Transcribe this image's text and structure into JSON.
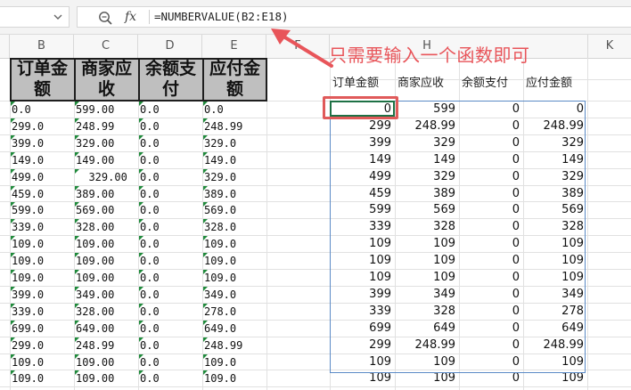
{
  "formula_bar": {
    "formula": "=NUMBERVALUE(B2:E18)",
    "fx_label": "fx"
  },
  "columns": [
    "B",
    "C",
    "D",
    "E",
    "F",
    "H",
    "K"
  ],
  "source_table": {
    "headers": [
      [
        "订单金",
        "额"
      ],
      [
        "商家应",
        "收"
      ],
      [
        "余额支",
        "付"
      ],
      [
        "应付金",
        "额"
      ]
    ],
    "rows": [
      [
        "0.0",
        "599.00",
        "0.0",
        "0.0"
      ],
      [
        "299.0",
        "248.99",
        "0.0",
        "248.99"
      ],
      [
        "399.0",
        "329.00",
        "0.0",
        "329.0"
      ],
      [
        "149.0",
        "149.00",
        "0.0",
        "149.0"
      ],
      [
        "499.0",
        "  329.00",
        "0.0",
        "329.0"
      ],
      [
        "459.0",
        "389.00",
        "0.0",
        "389.0"
      ],
      [
        "599.0",
        "569.00",
        "0.0",
        "569.0"
      ],
      [
        "339.0",
        "328.00",
        "0.0",
        "328.0"
      ],
      [
        "109.0",
        "109.00",
        "0.0",
        "109.0"
      ],
      [
        "109.0",
        "109.00",
        "0.0",
        "109.0"
      ],
      [
        "109.0",
        "109.00",
        "0.0",
        "109.0"
      ],
      [
        "399.0",
        "349.00",
        "0.0",
        "349.0"
      ],
      [
        "339.0",
        "328.00",
        "0.0",
        "278.0"
      ],
      [
        "699.0",
        "649.00",
        "0.0",
        "649.0"
      ],
      [
        "299.0",
        "248.99",
        "0.0",
        "248.99"
      ],
      [
        "109.0",
        "109.00",
        "0.0",
        "109.0"
      ],
      [
        "109.0",
        "109.00",
        "0.0",
        "109.0"
      ]
    ]
  },
  "result_table": {
    "headers": [
      "订单金额",
      "商家应收",
      "余额支付",
      "应付金额"
    ],
    "rows": [
      [
        "0",
        "599",
        "0",
        "0"
      ],
      [
        "299",
        "248.99",
        "0",
        "248.99"
      ],
      [
        "399",
        "329",
        "0",
        "329"
      ],
      [
        "149",
        "149",
        "0",
        "149"
      ],
      [
        "499",
        "329",
        "0",
        "329"
      ],
      [
        "459",
        "389",
        "0",
        "389"
      ],
      [
        "599",
        "569",
        "0",
        "569"
      ],
      [
        "339",
        "328",
        "0",
        "328"
      ],
      [
        "109",
        "109",
        "0",
        "109"
      ],
      [
        "109",
        "109",
        "0",
        "109"
      ],
      [
        "109",
        "109",
        "0",
        "109"
      ],
      [
        "399",
        "349",
        "0",
        "349"
      ],
      [
        "339",
        "328",
        "0",
        "278"
      ],
      [
        "699",
        "649",
        "0",
        "649"
      ],
      [
        "299",
        "248.99",
        "0",
        "248.99"
      ],
      [
        "109",
        "109",
        "0",
        "109"
      ],
      [
        "109",
        "109",
        "0",
        "109"
      ]
    ]
  },
  "annotation": {
    "text": "只需要输入一个函数即可",
    "color": "#e8555a"
  },
  "colors": {
    "selection_border": "#5b8ac6",
    "active_cell_border": "#1e7145",
    "error_triangle": "#1f8a3b",
    "header_fill": "#bfbfbf"
  }
}
